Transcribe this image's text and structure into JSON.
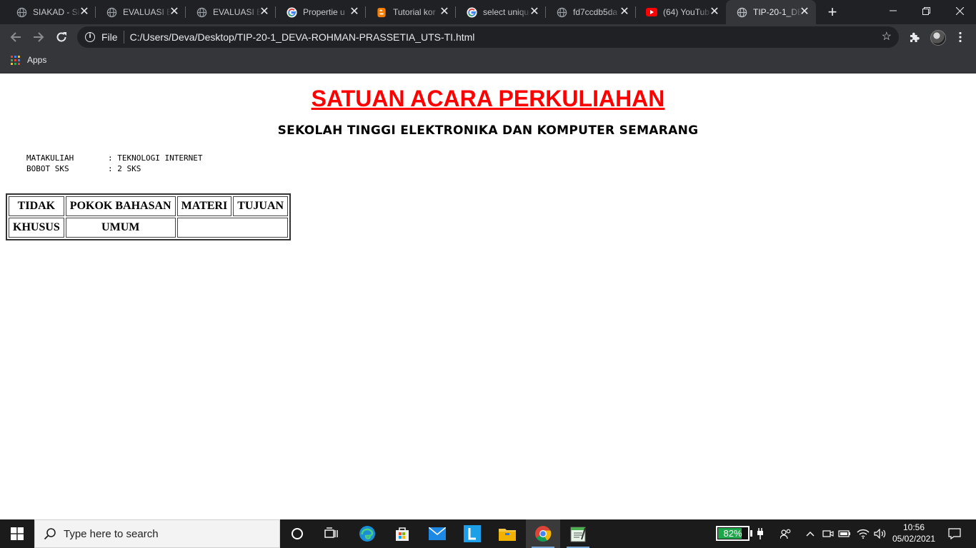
{
  "browser": {
    "tabs": [
      {
        "title": "SIAKAD - Si",
        "favicon": "globe-icon"
      },
      {
        "title": "EVALUASI B",
        "favicon": "globe-icon"
      },
      {
        "title": "EVALUASI B",
        "favicon": "globe-icon"
      },
      {
        "title": "Propertie u",
        "favicon": "google-icon"
      },
      {
        "title": "Tutorial kor",
        "favicon": "blogger-icon"
      },
      {
        "title": "select uniqu",
        "favicon": "google-icon"
      },
      {
        "title": "fd7ccdb5da",
        "favicon": "globe-icon"
      },
      {
        "title": "(64) YouTub",
        "favicon": "youtube-icon"
      },
      {
        "title": "TIP-20-1_DE",
        "favicon": "globe-icon",
        "active": true
      }
    ],
    "address": {
      "scheme": "File",
      "url": "C:/Users/Deva/Desktop/TIP-20-1_DEVA-ROHMAN-PRASSETIA_UTS-TI.html"
    },
    "bookmarks": {
      "apps_label": "Apps"
    }
  },
  "page": {
    "title": "SATUAN ACARA PERKULIAHAN",
    "subtitle": "SEKOLAH TINGGI ELEKTRONIKA DAN KOMPUTER SEMARANG",
    "info": [
      {
        "key": "MATAKULIAH",
        "value": ": TEKNOLOGI INTERNET"
      },
      {
        "key": "BOBOT SKS",
        "value": ": 2 SKS"
      }
    ],
    "table": {
      "row1": [
        "TIDAK",
        "POKOK BAHASAN",
        "MATERI",
        "TUJUAN"
      ],
      "row2": [
        "KHUSUS",
        "UMUM",
        ""
      ]
    }
  },
  "taskbar": {
    "search_placeholder": "Type here to search",
    "battery_percent": "82%",
    "battery_level": 0.82,
    "time": "10:56",
    "date": "05/02/2021",
    "pinned": [
      "task-view-icon",
      "edge-icon",
      "store-icon",
      "mail-icon",
      "l-app-icon",
      "file-explorer-icon",
      "chrome-icon",
      "notepad-icon"
    ]
  },
  "colors": {
    "title_red": "#ff0000",
    "chrome_dark": "#202124",
    "chrome_toolbar": "#35363a",
    "taskbar": "#1b1b1c",
    "battery_green": "#1fa64a"
  }
}
